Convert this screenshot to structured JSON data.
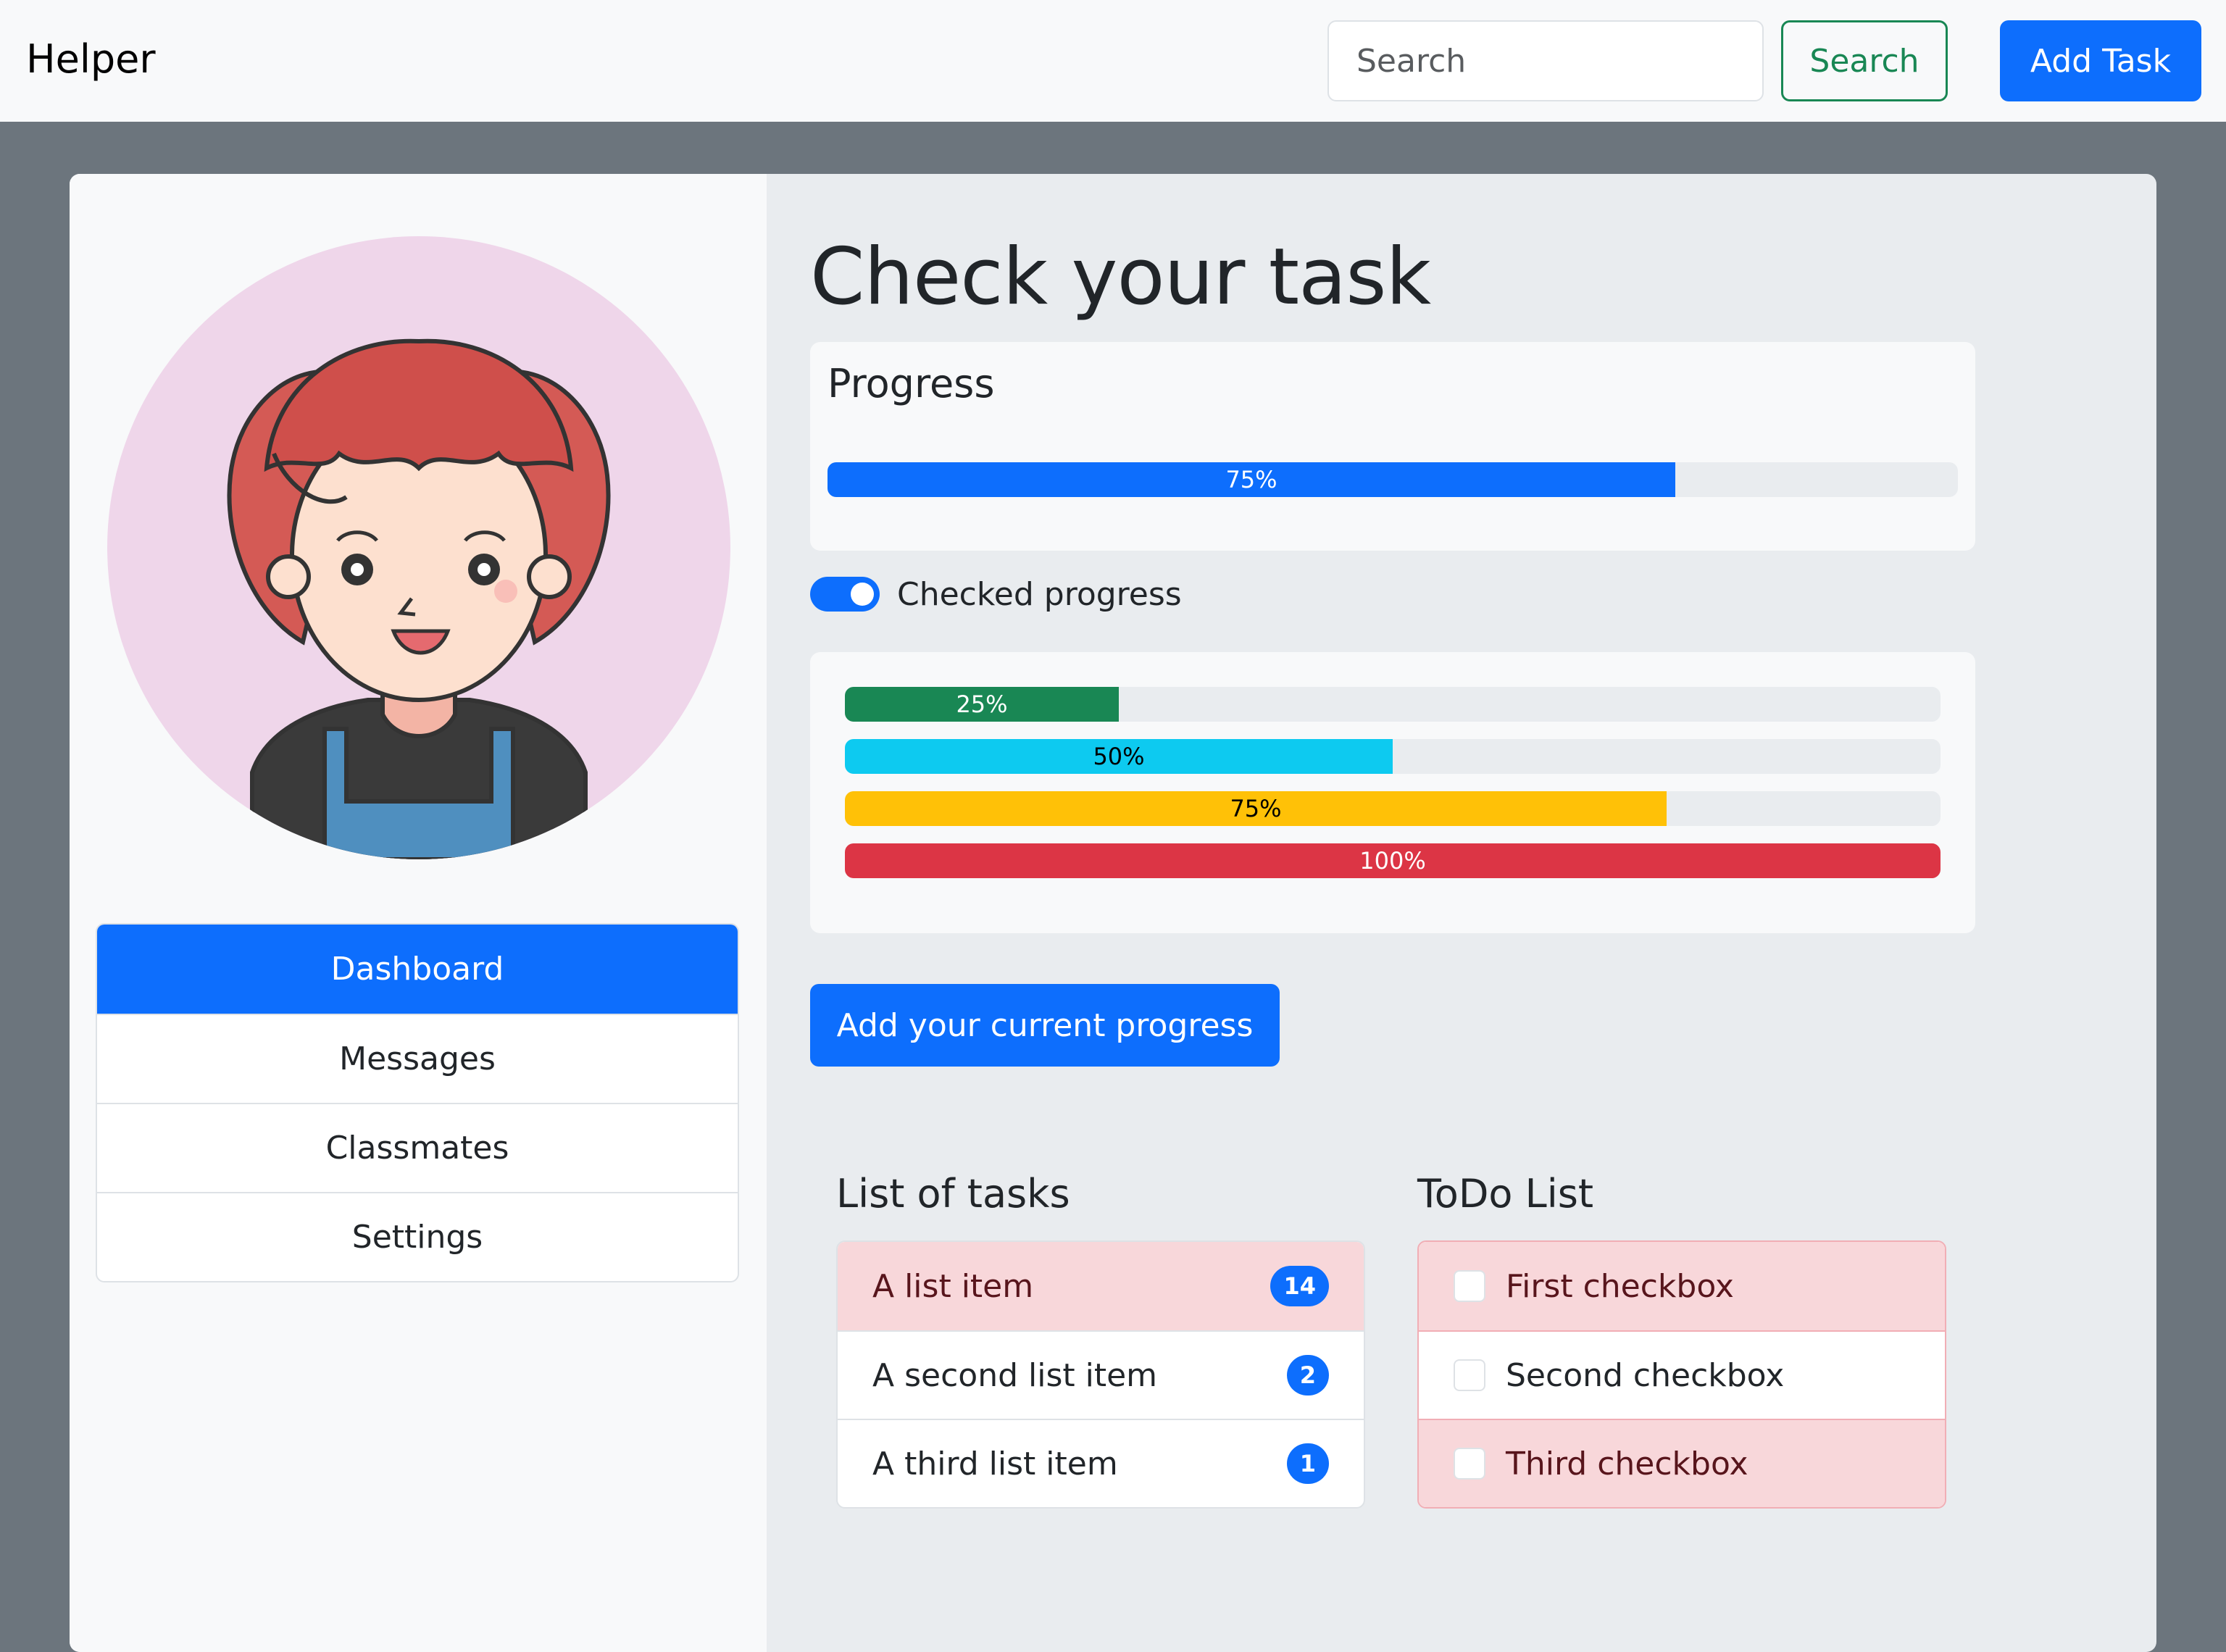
{
  "navbar": {
    "brand": "Helper",
    "search_placeholder": "Search",
    "search_button": "Search",
    "add_task_button": "Add Task"
  },
  "sidebar": {
    "avatar_icon": "avatar-illustration",
    "items": [
      {
        "label": "Dashboard",
        "active": true
      },
      {
        "label": "Messages"
      },
      {
        "label": "Classmates"
      },
      {
        "label": "Settings"
      }
    ]
  },
  "main": {
    "title": "Check your task",
    "progress": {
      "heading": "Progress",
      "value": 75,
      "label": "75%",
      "color": "#0d6efd"
    },
    "switch_label": "Checked progress",
    "bars": [
      {
        "label": "25%",
        "value": 25,
        "color": "#198754",
        "text_color": "#ffffff"
      },
      {
        "label": "50%",
        "value": 50,
        "color": "#0dcaf0",
        "text_color": "#000000"
      },
      {
        "label": "75%",
        "value": 75,
        "color": "#ffc107",
        "text_color": "#000000"
      },
      {
        "label": "100%",
        "value": 100,
        "color": "#dc3545",
        "text_color": "#ffffff"
      }
    ],
    "add_progress_button": "Add your current progress",
    "tasks": {
      "heading": "List of tasks",
      "items": [
        {
          "label": "A list item",
          "badge": "14"
        },
        {
          "label": "A second list item",
          "badge": "2"
        },
        {
          "label": "A third list item",
          "badge": "1"
        }
      ]
    },
    "todo": {
      "heading": "ToDo List",
      "items": [
        {
          "label": "First checkbox"
        },
        {
          "label": "Second checkbox"
        },
        {
          "label": "Third checkbox"
        }
      ]
    }
  }
}
